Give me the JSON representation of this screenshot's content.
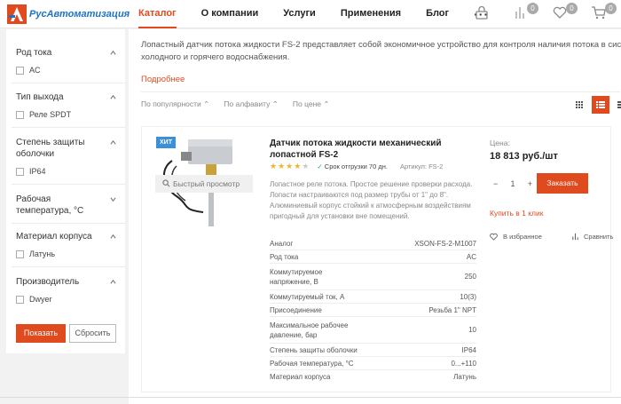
{
  "brand": {
    "name": "РусАвтоматизация",
    "accent": "#e04a1f",
    "logo_blue": "#1a73c8"
  },
  "nav": {
    "items": [
      "Каталог",
      "О компании",
      "Услуги",
      "Применения",
      "Блог"
    ],
    "more": "···"
  },
  "header_icons": [
    {
      "name": "lock-icon",
      "badge": ""
    },
    {
      "name": "compare-icon",
      "badge": "0"
    },
    {
      "name": "heart-icon",
      "badge": "0"
    },
    {
      "name": "cart-icon",
      "badge": "0"
    }
  ],
  "filters": {
    "groups": [
      {
        "title": "Род тока",
        "option": "AC"
      },
      {
        "title": "Тип выхода",
        "option": "Реле SPDT"
      },
      {
        "title": "Степень защиты оболочки",
        "option": "IP64"
      },
      {
        "title": "Рабочая температура, °C",
        "option": ""
      },
      {
        "title": "Материал корпуса",
        "option": "Латунь"
      },
      {
        "title": "Производитель",
        "option": "Dwyer"
      }
    ],
    "show_label": "Показать",
    "reset_label": "Сбросить"
  },
  "category": {
    "description_line1": "Лопастный датчик потока жидкости FS-2 представляет собой экономичное устройство для контроля наличия потока в систем",
    "description_line2": "холодного и горячего водоснабжения.",
    "more_label": "Подробнее"
  },
  "sorting": {
    "items": [
      "По популярности",
      "По алфавиту",
      "По цене"
    ],
    "arrow": "⌃"
  },
  "product": {
    "badge": "ХИТ",
    "quick_view": "Быстрый просмотр",
    "title": "Датчик потока жидкости механический лопастной FS-2",
    "rating": 4,
    "rating_max": 5,
    "shipping": "Срок отгрузки 70 дн.",
    "article": "Артикул: FS-2",
    "description": "Лопастное реле потока. Простое решение проверки расхода. Лопасти настраиваются под размер трубы от 1\" до 8\". Алюминиевый корпус стойкий к атмосферным воздействиям пригодный для установки вне помещений.",
    "specs": [
      {
        "k": "Аналог",
        "v": "XSON-FS-2-M1007"
      },
      {
        "k": "Род тока",
        "v": "AC"
      },
      {
        "k": "Коммутируемое напряжение, В",
        "v": "250"
      },
      {
        "k": "Коммутируемый ток, А",
        "v": "10(3)"
      },
      {
        "k": "Присоединение",
        "v": "Резьба 1\" NPT"
      },
      {
        "k": "Максимальное рабочее давление, бар",
        "v": "10"
      },
      {
        "k": "Степень защиты оболочки",
        "v": "IP64"
      },
      {
        "k": "Рабочая температура, °C",
        "v": "0...+110"
      },
      {
        "k": "Материал корпуса",
        "v": "Латунь"
      }
    ],
    "price_label": "Цена:",
    "price": "18 813 руб./шт",
    "qty": "1",
    "qty_minus": "−",
    "qty_plus": "+",
    "buy_label": "Заказать",
    "one_click": "Купить в 1 клик",
    "wishlist": "В избранное",
    "compare": "Сравнить"
  }
}
